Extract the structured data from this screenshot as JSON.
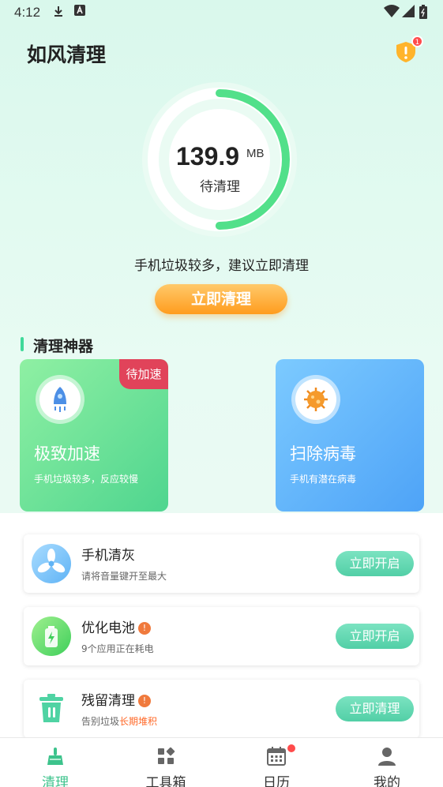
{
  "status_bar": {
    "time": "4:12",
    "icons": [
      "download-icon",
      "a-icon",
      "wifi-icon",
      "signal-icon",
      "battery-icon"
    ]
  },
  "header": {
    "title": "如风清理",
    "badge_count": "1"
  },
  "gauge": {
    "value": "139.9",
    "unit": "MB",
    "label": "待清理",
    "progress": 0.5
  },
  "suggestion": "手机垃圾较多，建议立即清理",
  "clean_button": "立即清理",
  "section_title": "清理神器",
  "cards": [
    {
      "title": "极致加速",
      "desc": "手机垃圾较多，反应较慢",
      "tag": "待加速",
      "icon": "rocket-icon"
    },
    {
      "title": "扫除病毒",
      "desc": "手机有潜在病毒",
      "icon": "virus-icon"
    }
  ],
  "tools": [
    {
      "title": "手机清灰",
      "desc": "请将音量键开至最大",
      "button": "立即开启",
      "icon": "fan-icon"
    },
    {
      "title": "优化电池",
      "desc": "9个应用正在耗电",
      "button": "立即开启",
      "icon": "battery-icon",
      "warn": "!"
    },
    {
      "title": "残留清理",
      "desc_prefix": "告别垃圾",
      "desc_highlight": "长期堆积",
      "button": "立即清理",
      "icon": "trash-icon",
      "warn": "!"
    }
  ],
  "tabs": [
    {
      "label": "清理",
      "icon": "broom-icon",
      "active": true
    },
    {
      "label": "工具箱",
      "icon": "grid-icon"
    },
    {
      "label": "日历",
      "icon": "calendar-icon"
    },
    {
      "label": "我的",
      "icon": "user-icon"
    }
  ],
  "colors": {
    "accent": "#3dc38c",
    "orange_button": "#ff9c1e",
    "green_card": "#4fd58f",
    "blue_card": "#4ea3f7",
    "tag_red": "#e1435a"
  }
}
